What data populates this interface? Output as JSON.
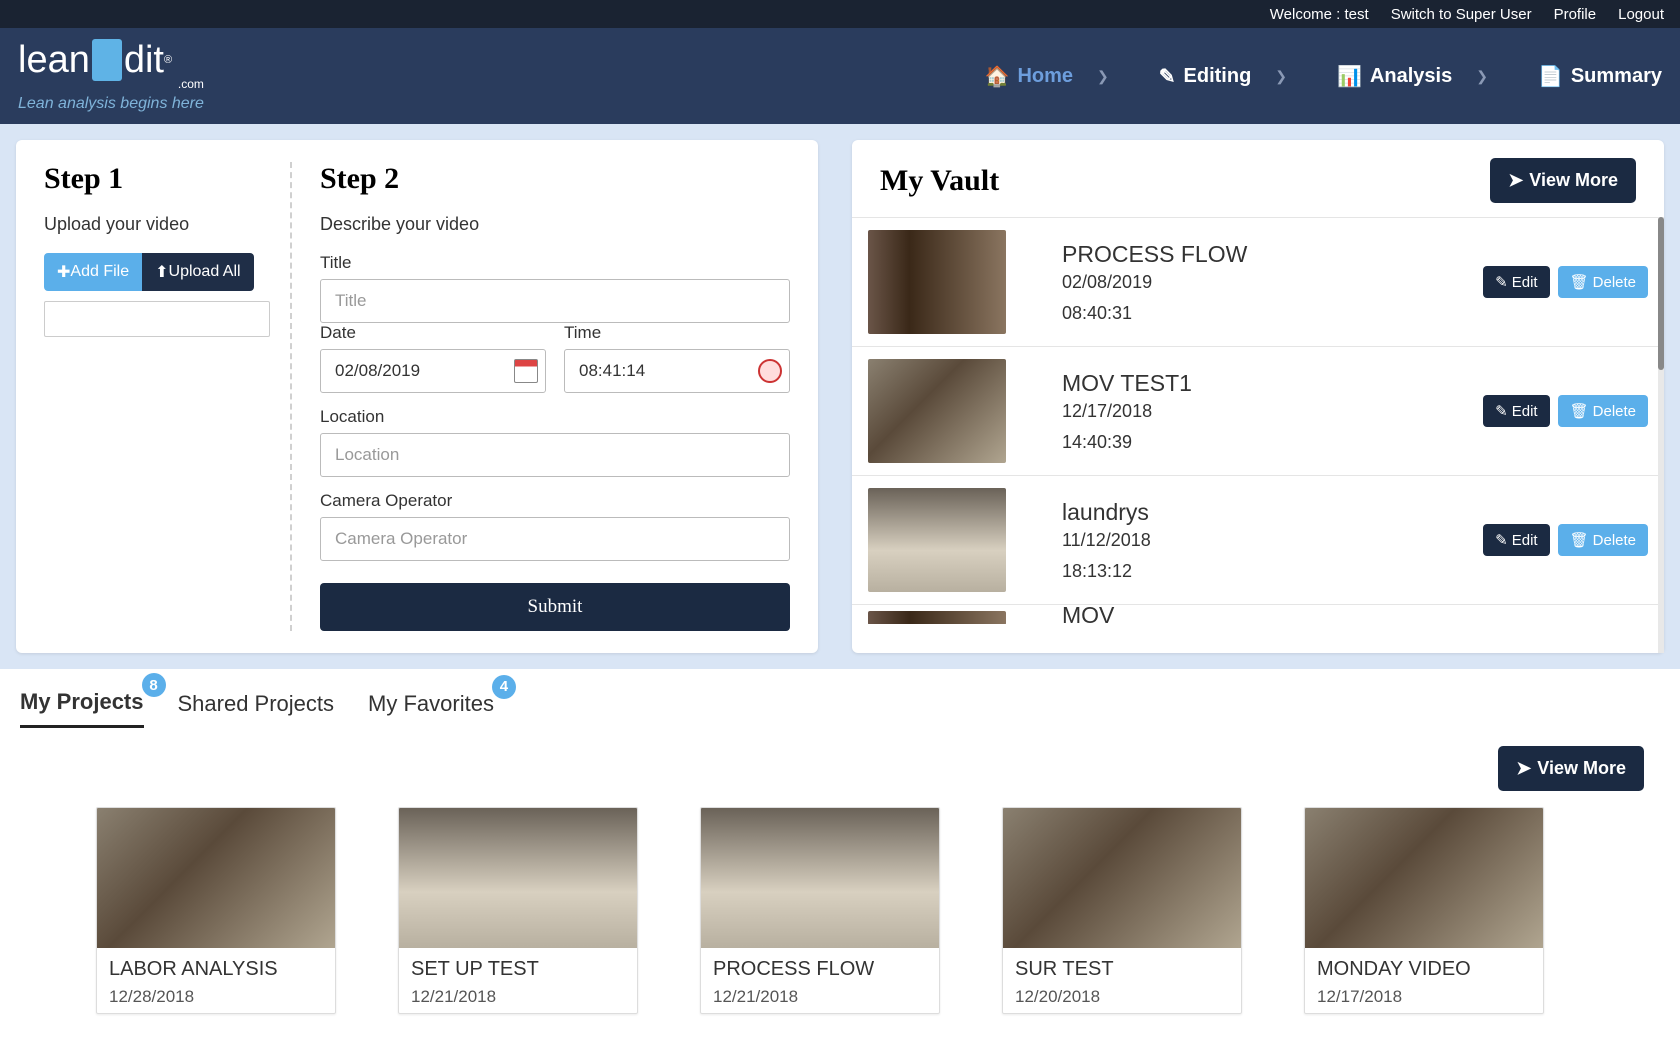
{
  "topbar": {
    "welcome": "Welcome : test",
    "switch": "Switch to Super User",
    "profile": "Profile",
    "logout": "Logout"
  },
  "logo": {
    "text": "leanEdit",
    "suffix": ".com",
    "tagline": "Lean analysis begins here"
  },
  "nav": {
    "home": "Home",
    "editing": "Editing",
    "analysis": "Analysis",
    "summary": "Summary"
  },
  "step1": {
    "title": "Step 1",
    "subtitle": "Upload your video",
    "add_file": "Add File",
    "upload_all": "Upload All"
  },
  "step2": {
    "title": "Step 2",
    "subtitle": "Describe your video",
    "title_label": "Title",
    "title_placeholder": "Title",
    "date_label": "Date",
    "date_value": "02/08/2019",
    "time_label": "Time",
    "time_value": "08:41:14",
    "location_label": "Location",
    "location_placeholder": "Location",
    "operator_label": "Camera Operator",
    "operator_placeholder": "Camera Operator",
    "submit": "Submit"
  },
  "vault": {
    "title": "My Vault",
    "view_more": "View More",
    "edit": "Edit",
    "delete": "Delete",
    "items": [
      {
        "name": "PROCESS FLOW",
        "date": "02/08/2019",
        "time": "08:40:31"
      },
      {
        "name": "MOV TEST1",
        "date": "12/17/2018",
        "time": "14:40:39"
      },
      {
        "name": "laundrys",
        "date": "11/12/2018",
        "time": "18:13:12"
      }
    ],
    "partial_name": "MOV"
  },
  "tabs": {
    "my_projects": "My Projects",
    "my_projects_badge": "8",
    "shared": "Shared Projects",
    "favorites": "My Favorites",
    "favorites_badge": "4"
  },
  "projects": {
    "view_more": "View More",
    "items": [
      {
        "title": "LABOR ANALYSIS",
        "date": "12/28/2018",
        "thumb": "kitchen"
      },
      {
        "title": "SET UP TEST",
        "date": "12/21/2018",
        "thumb": "laundry"
      },
      {
        "title": "PROCESS FLOW",
        "date": "12/21/2018",
        "thumb": "laundry"
      },
      {
        "title": "SUR TEST",
        "date": "12/20/2018",
        "thumb": "kitchen"
      },
      {
        "title": "MONDAY VIDEO",
        "date": "12/17/2018",
        "thumb": "kitchen"
      }
    ]
  }
}
